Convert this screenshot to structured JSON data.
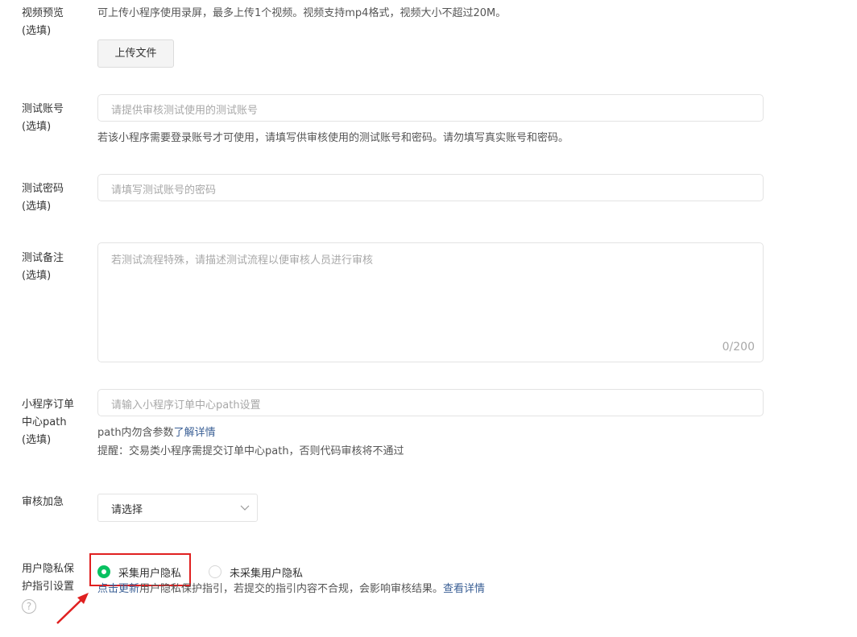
{
  "video_preview": {
    "label": "视频预览\n(选填)",
    "hint": "可上传小程序使用录屏，最多上传1个视频。视频支持mp4格式，视频大小不超过20M。",
    "upload_button": "上传文件"
  },
  "test_account": {
    "label": "测试账号\n(选填)",
    "placeholder": "请提供审核测试使用的测试账号",
    "hint": "若该小程序需要登录账号才可使用，请填写供审核使用的测试账号和密码。请勿填写真实账号和密码。"
  },
  "test_password": {
    "label": "测试密码\n(选填)",
    "placeholder": "请填写测试账号的密码"
  },
  "test_notes": {
    "label": "测试备注\n(选填)",
    "placeholder": "若测试流程特殊，请描述测试流程以便审核人员进行审核",
    "counter": "0/200"
  },
  "order_path": {
    "label": "小程序订单\n中心path\n(选填)",
    "placeholder": "请输入小程序订单中心path设置",
    "hint_prefix": "path内勿含参数",
    "hint_link": "了解详情",
    "reminder": "提醒：交易类小程序需提交订单中心path，否则代码审核将不通过"
  },
  "expedite": {
    "label": "审核加急",
    "select_value": "请选择"
  },
  "privacy": {
    "label": "用户隐私保\n护指引设置",
    "option_collect": "采集用户隐私",
    "option_not_collect": "未采集用户隐私",
    "update_link": "点击更新",
    "hint_text": "用户隐私保护指引，若提交的指引内容不合规，会影响审核结果。",
    "details_link": "查看详情",
    "help_icon_glyph": "?"
  },
  "colors": {
    "accent_green": "#07c160",
    "link_blue": "#3a5f95",
    "annotation_red": "#e02020"
  }
}
